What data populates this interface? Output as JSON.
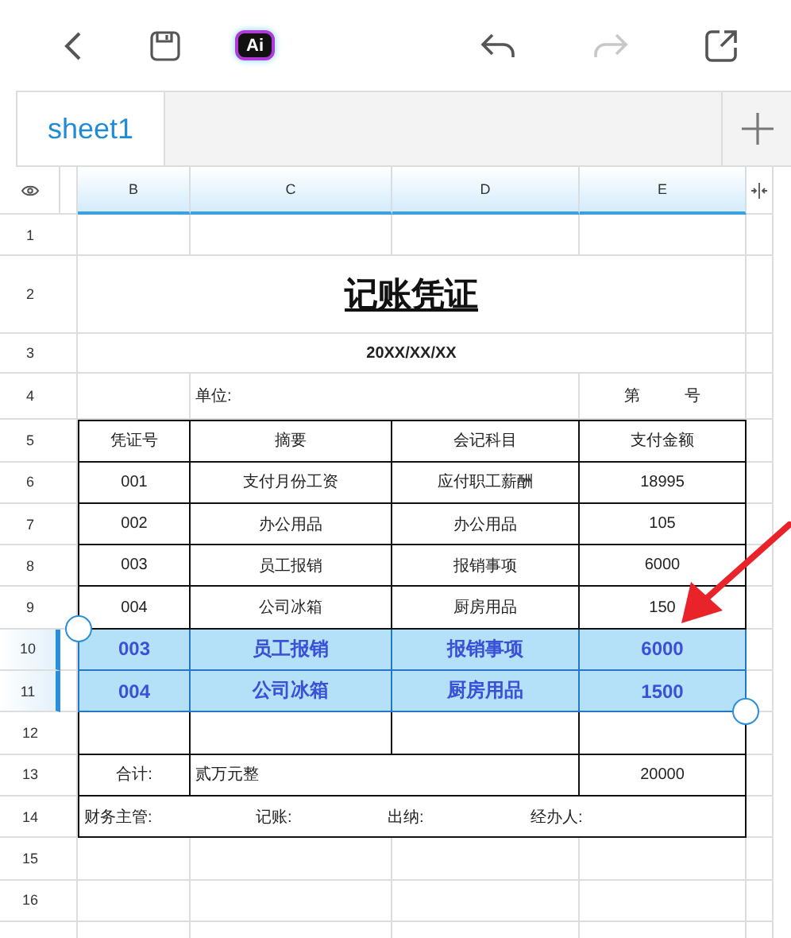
{
  "toolbar": {
    "ai_label": "Ai",
    "redo_disabled": true
  },
  "tabs": [
    {
      "label": "sheet1",
      "selected": true
    }
  ],
  "columns": [
    "B",
    "C",
    "D",
    "E"
  ],
  "rows": [
    {
      "number": "1",
      "kind": "blank",
      "selected": false
    },
    {
      "number": "2",
      "kind": "title",
      "selected": false,
      "text": "记账凭证"
    },
    {
      "number": "3",
      "kind": "subtitle",
      "selected": false,
      "text": "20XX/XX/XX"
    },
    {
      "number": "4",
      "kind": "unit",
      "selected": false,
      "unit_label": "单位:",
      "number_label": [
        "第",
        "号"
      ]
    },
    {
      "number": "5",
      "kind": "header",
      "selected": false,
      "cells": [
        "凭证号",
        "摘要",
        "会记科目",
        "支付金额"
      ]
    },
    {
      "number": "6",
      "kind": "entry",
      "selected": false,
      "cells": [
        "001",
        "支付月份工资",
        "应付职工薪酬",
        "18995"
      ]
    },
    {
      "number": "7",
      "kind": "entry",
      "selected": false,
      "cells": [
        "002",
        "办公用品",
        "办公用品",
        "105"
      ]
    },
    {
      "number": "8",
      "kind": "entry",
      "selected": false,
      "cells": [
        "003",
        "员工报销",
        "报销事项",
        "6000"
      ]
    },
    {
      "number": "9",
      "kind": "entry",
      "selected": false,
      "cells": [
        "004",
        "公司冰箱",
        "厨房用品",
        "150"
      ]
    },
    {
      "number": "10",
      "kind": "entry",
      "selected": true,
      "cells": [
        "003",
        "员工报销",
        "报销事项",
        "6000"
      ]
    },
    {
      "number": "11",
      "kind": "entry",
      "selected": true,
      "cells": [
        "004",
        "公司冰箱",
        "厨房用品",
        "1500"
      ]
    },
    {
      "number": "12",
      "kind": "boxed_blank",
      "selected": false
    },
    {
      "number": "13",
      "kind": "total",
      "selected": false,
      "label": "合计:",
      "words": "贰万元整",
      "amount": "20000"
    },
    {
      "number": "14",
      "kind": "signatures",
      "selected": false,
      "labels": [
        "财务主管:",
        "记账:",
        "出纳:",
        "经办人:"
      ]
    },
    {
      "number": "15",
      "kind": "blank",
      "selected": false
    },
    {
      "number": "16",
      "kind": "blank",
      "selected": false
    }
  ]
}
